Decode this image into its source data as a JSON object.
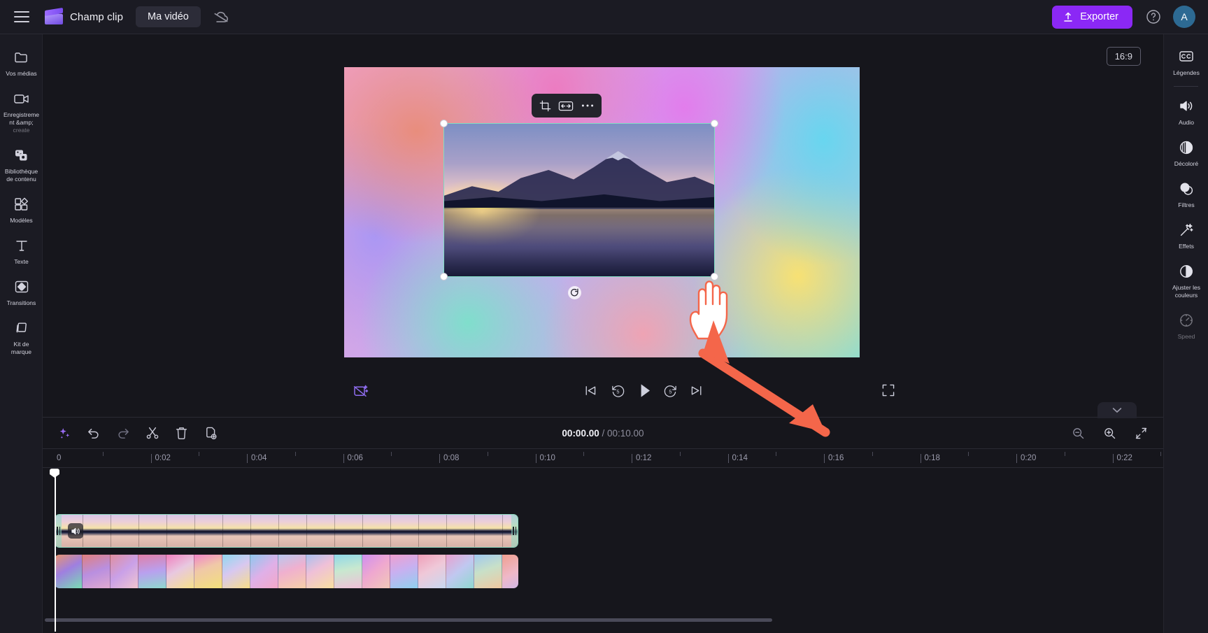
{
  "app": {
    "title": "Champ clip",
    "project_name": "Ma vidéo",
    "menu_icon": "hamburger-icon",
    "cloud_icon": "cloud-off-icon",
    "export_label": "Exporter",
    "help_icon": "help-circle-icon",
    "avatar_initial": "A",
    "accent_color": "#8b28f5",
    "selection_color": "#7fdcc2",
    "arrow_color": "#f4664a"
  },
  "left_rail": {
    "collapse_icon": "chevron-right-icon",
    "items": [
      {
        "label": "Vos médias",
        "icon": "folder-icon",
        "dim": false
      },
      {
        "label": "Enregistrement &amp;",
        "sublabel": "create",
        "icon": "video-camera-icon",
        "dim": false
      },
      {
        "label": "Bibliothèque de contenu",
        "icon": "content-library-icon",
        "dim": false
      },
      {
        "label": "Modèles",
        "icon": "templates-icon",
        "dim": false
      },
      {
        "label": "Texte",
        "icon": "text-icon",
        "dim": false
      },
      {
        "label": "Transitions",
        "icon": "transitions-icon",
        "dim": false
      },
      {
        "label": "Kit de marque",
        "icon": "brand-kit-icon",
        "dim": false
      }
    ]
  },
  "right_rail": {
    "collapse_icon": "chevron-left-icon",
    "items": [
      {
        "label": "Légendes",
        "icon": "closed-captions-icon",
        "dim": false
      },
      {
        "label": "Audio",
        "icon": "speaker-icon",
        "dim": false
      },
      {
        "label": "Décoloré",
        "icon": "fade-icon",
        "dim": false
      },
      {
        "label": "Filtres",
        "icon": "filters-icon",
        "dim": false
      },
      {
        "label": "Effets",
        "icon": "effects-wand-icon",
        "dim": false
      },
      {
        "label": "Ajuster les couleurs",
        "icon": "adjust-colors-icon",
        "dim": false
      },
      {
        "label": "Speed",
        "icon": "speed-gauge-icon",
        "dim": true
      }
    ]
  },
  "preview": {
    "aspect_ratio": "16:9",
    "element_toolbar": [
      {
        "name": "crop-button",
        "icon": "crop-icon"
      },
      {
        "name": "fit-width-button",
        "icon": "fit-width-icon"
      },
      {
        "name": "more-options-button",
        "icon": "ellipsis-icon"
      }
    ],
    "rotate_icon": "rotate-icon",
    "handles": [
      "top-left",
      "top-right",
      "bottom-left",
      "bottom-right"
    ],
    "cursor": "hand-pointer"
  },
  "playback": {
    "auto_compose_icon": "auto-compose-icon",
    "skip_back_icon": "skip-previous-icon",
    "back5_icon": "rewind-5-icon",
    "back5_label": "5",
    "play_icon": "play-icon",
    "fwd5_icon": "forward-5-icon",
    "fwd5_label": "5",
    "skip_fwd_icon": "skip-next-icon",
    "fullscreen_icon": "fullscreen-icon"
  },
  "timeline": {
    "collapse_tab_icon": "chevron-down-icon",
    "tools": [
      {
        "name": "magic-tools-button",
        "icon": "sparkle-icon"
      },
      {
        "name": "undo-button",
        "icon": "undo-icon"
      },
      {
        "name": "redo-button",
        "icon": "redo-icon"
      },
      {
        "name": "split-button",
        "icon": "scissors-icon"
      },
      {
        "name": "delete-button",
        "icon": "trash-icon"
      },
      {
        "name": "duplicate-button",
        "icon": "duplicate-icon"
      }
    ],
    "current_time": "00:00.00",
    "separator": "/",
    "total_time": "00:10.00",
    "zoom_out_icon": "zoom-out-icon",
    "zoom_in_icon": "zoom-in-icon",
    "fit-timeline_icon": "collapse-arrows-icon",
    "ruler_labels": [
      "0",
      "0:02",
      "0:04",
      "0:06",
      "0:08",
      "0:10",
      "0:12",
      "0:14",
      "0:16",
      "0:18",
      "0:20",
      "0:22"
    ],
    "playhead_time": "0",
    "clips": [
      {
        "name": "video-clip",
        "type": "video",
        "selected": true,
        "mute_icon": "speaker-icon"
      },
      {
        "name": "gradient-clip",
        "type": "background",
        "selected": false
      }
    ]
  }
}
